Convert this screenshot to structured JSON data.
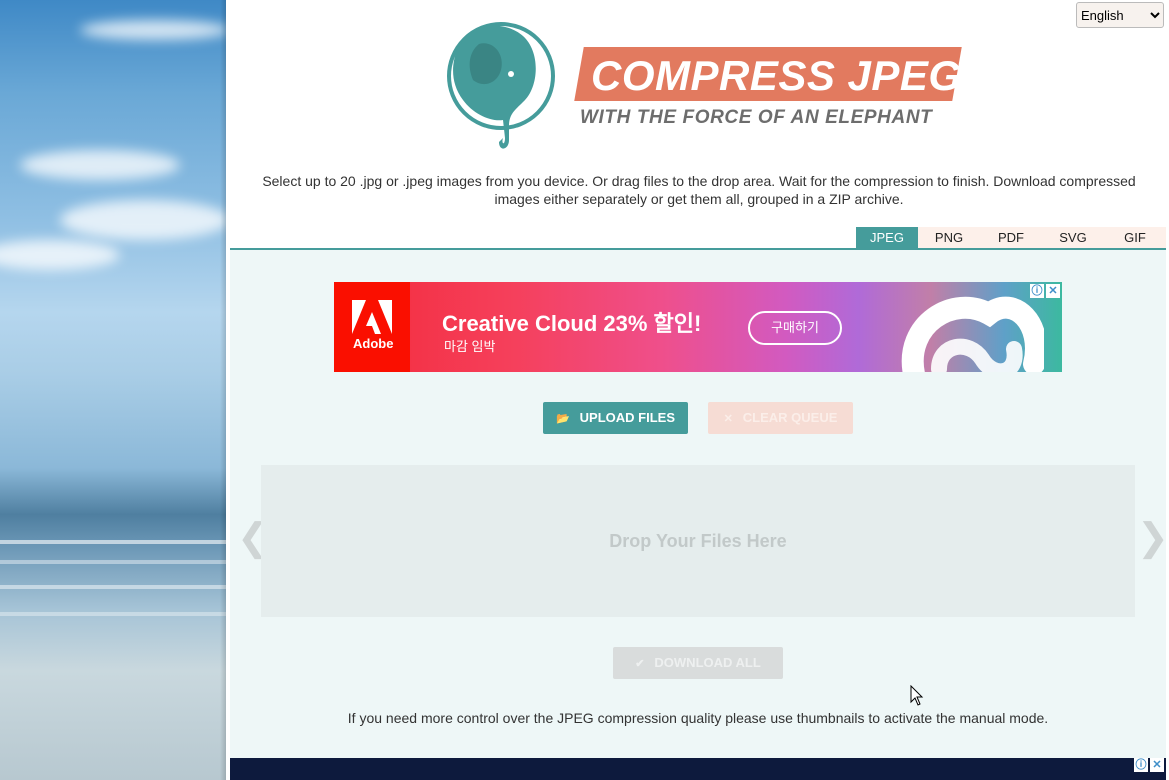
{
  "colors": {
    "accent": "#459c9b",
    "brand_orange": "#e27a5f",
    "tagline_gray": "#6d6d6d",
    "adobe_red": "#fa0f00",
    "main_area_bg": "#eef7f7"
  },
  "language": {
    "selected": "English"
  },
  "logo": {
    "title": "COMPRESS JPEG",
    "tagline": "WITH THE FORCE OF AN ELEPHANT",
    "icon": "elephant-icon"
  },
  "intro_text": "Select up to 20 .jpg or .jpeg images from you device. Or drag files to the drop area. Wait for the compression to finish. Download compressed images either separately or get them all, grouped in a ZIP archive.",
  "tabs": [
    {
      "label": "JPEG",
      "active": true
    },
    {
      "label": "PNG",
      "active": false
    },
    {
      "label": "PDF",
      "active": false
    },
    {
      "label": "SVG",
      "active": false
    },
    {
      "label": "GIF",
      "active": false
    }
  ],
  "ad": {
    "brand": "Adobe",
    "title": "Creative Cloud 23% 할인!",
    "subtitle": "마감 임박",
    "cta": "구매하기",
    "info_glyph": "ⓘ",
    "close_glyph": "✕"
  },
  "buttons": {
    "upload": {
      "label": "UPLOAD FILES",
      "icon": "folder-open-icon"
    },
    "clear": {
      "label": "CLEAR QUEUE",
      "icon": "close-icon"
    },
    "download_all": {
      "label": "DOWNLOAD ALL",
      "icon": "check-icon"
    }
  },
  "dropzone": {
    "text": "Drop Your Files Here"
  },
  "nav": {
    "prev_glyph": "❮",
    "next_glyph": "❯"
  },
  "manual_note": "If you need more control over the JPEG compression quality please use thumbnails to activate the manual mode."
}
